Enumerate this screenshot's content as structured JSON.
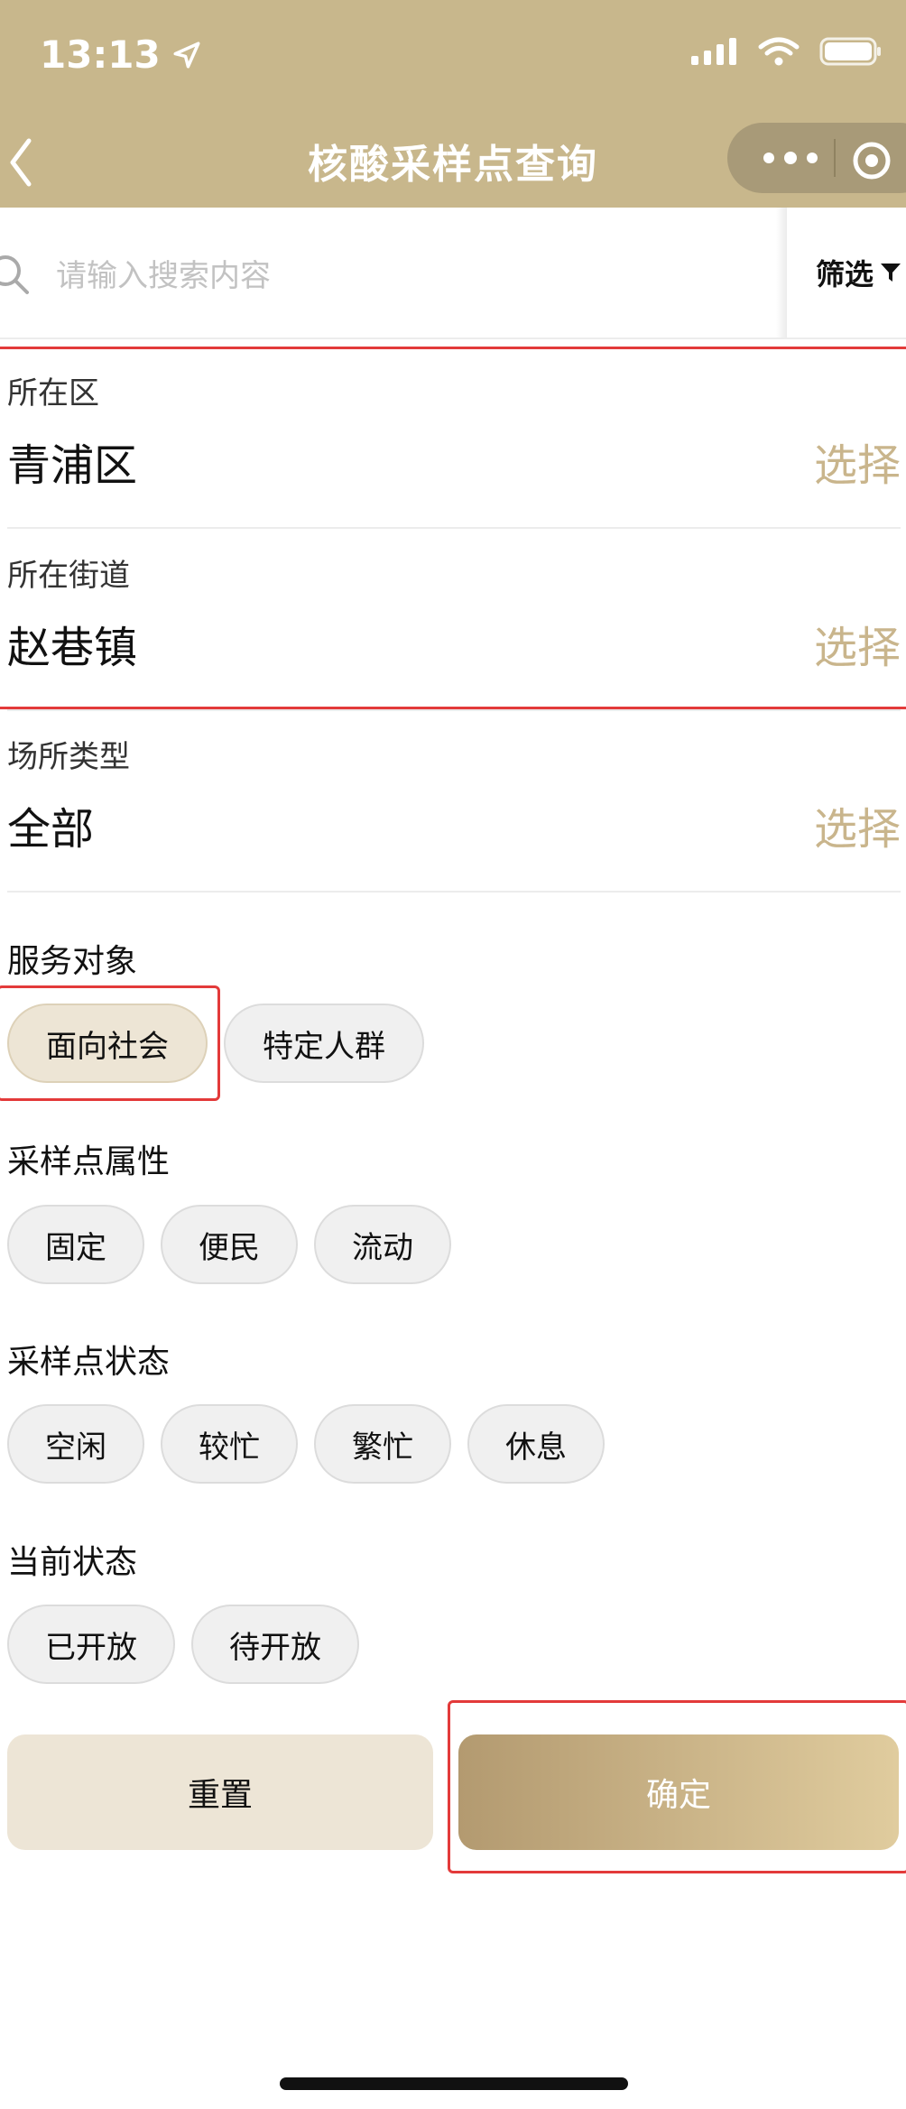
{
  "status_bar": {
    "time": "13:13",
    "icons": [
      "location-arrow-icon",
      "cellular-signal-icon",
      "wifi-icon",
      "battery-icon"
    ]
  },
  "nav": {
    "title": "核酸采样点查询",
    "back_icon": "chevron-left-icon",
    "more_icon": "more-dots-icon",
    "close_icon": "target-close-icon"
  },
  "search": {
    "placeholder": "请输入搜索内容",
    "value": "",
    "filter_label": "筛选",
    "filter_icon": "funnel-icon"
  },
  "fields": [
    {
      "label": "所在区",
      "value": "青浦区",
      "action": "选择"
    },
    {
      "label": "所在街道",
      "value": "赵巷镇",
      "action": "选择"
    },
    {
      "label": "场所类型",
      "value": "全部",
      "action": "选择"
    }
  ],
  "groups": [
    {
      "title": "服务对象",
      "options": [
        {
          "label": "面向社会",
          "selected": true
        },
        {
          "label": "特定人群",
          "selected": false
        }
      ]
    },
    {
      "title": "采样点属性",
      "options": [
        {
          "label": "固定",
          "selected": false
        },
        {
          "label": "便民",
          "selected": false
        },
        {
          "label": "流动",
          "selected": false
        }
      ]
    },
    {
      "title": "采样点状态",
      "options": [
        {
          "label": "空闲",
          "selected": false
        },
        {
          "label": "较忙",
          "selected": false
        },
        {
          "label": "繁忙",
          "selected": false
        },
        {
          "label": "休息",
          "selected": false
        }
      ]
    },
    {
      "title": "当前状态",
      "options": [
        {
          "label": "已开放",
          "selected": false
        },
        {
          "label": "待开放",
          "selected": false
        }
      ]
    }
  ],
  "actions": {
    "reset_label": "重置",
    "confirm_label": "确定"
  },
  "colors": {
    "header": "#c8b78c",
    "accent_text": "#c9b58c",
    "selected_chip": "#ede5d5",
    "highlight": "#e33a3a"
  }
}
